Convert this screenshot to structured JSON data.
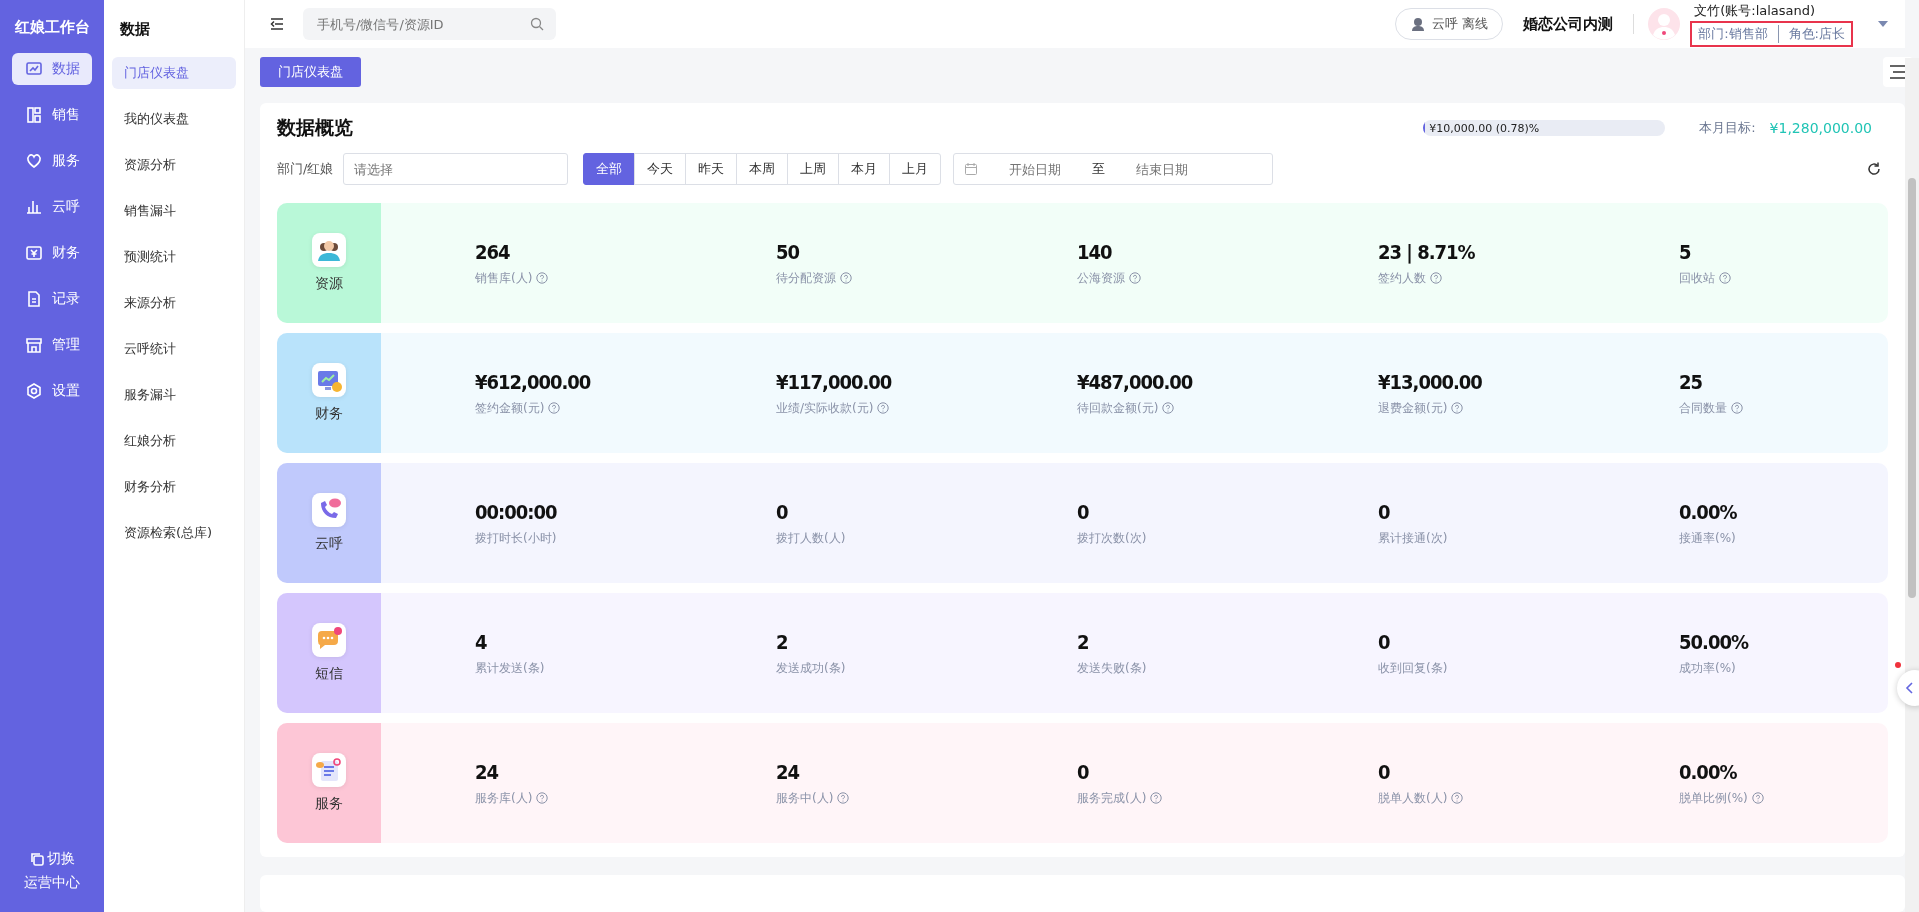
{
  "rail": {
    "title": "红娘工作台",
    "items": [
      {
        "label": "数据",
        "kind": "chart",
        "selected": true
      },
      {
        "label": "销售",
        "kind": "grid",
        "selected": false
      },
      {
        "label": "服务",
        "kind": "heart",
        "selected": false
      },
      {
        "label": "云呼",
        "kind": "bars",
        "selected": false
      },
      {
        "label": "财务",
        "kind": "money",
        "selected": false
      },
      {
        "label": "记录",
        "kind": "doc",
        "selected": false
      },
      {
        "label": "管理",
        "kind": "shop",
        "selected": false
      },
      {
        "label": "设置",
        "kind": "gear",
        "selected": false
      }
    ],
    "switch": {
      "label": "切换",
      "sub": "运营中心"
    }
  },
  "submenu": {
    "title": "数据",
    "items": [
      {
        "label": "门店仪表盘",
        "selected": true
      },
      {
        "label": "我的仪表盘",
        "selected": false
      },
      {
        "label": "资源分析",
        "selected": false
      },
      {
        "label": "销售漏斗",
        "selected": false
      },
      {
        "label": "预测统计",
        "selected": false
      },
      {
        "label": "来源分析",
        "selected": false
      },
      {
        "label": "云呼统计",
        "selected": false
      },
      {
        "label": "服务漏斗",
        "selected": false
      },
      {
        "label": "红娘分析",
        "selected": false
      },
      {
        "label": "财务分析",
        "selected": false
      },
      {
        "label": "资源检索(总库)",
        "selected": false
      }
    ]
  },
  "header": {
    "search": {
      "placeholder": "手机号/微信号/资源ID"
    },
    "call_status": "云呼 离线",
    "company": "婚恋公司内测",
    "user": {
      "name": "文竹(账号:lalasand)",
      "department": "部门:销售部",
      "role": "角色:店长"
    }
  },
  "page_tabs": [
    {
      "label": "门店仪表盘",
      "selected": true
    }
  ],
  "overview": {
    "title": "数据概览",
    "progress": {
      "level": 0.0078,
      "reading": "¥10,000.00 (0.78)%"
    },
    "target_label": "本月目标:",
    "target_value": "¥1,280,000.00",
    "filter_label": "部门/红娘",
    "filter": {
      "placeholder": "请选择"
    },
    "periods": [
      {
        "label": "全部",
        "selected": true
      },
      {
        "label": "今天",
        "selected": false
      },
      {
        "label": "昨天",
        "selected": false
      },
      {
        "label": "本周",
        "selected": false
      },
      {
        "label": "上周",
        "selected": false
      },
      {
        "label": "本月",
        "selected": false
      },
      {
        "label": "上月",
        "selected": false
      }
    ],
    "date_range": {
      "start_placeholder": "开始日期",
      "separator": "至",
      "end_placeholder": "结束日期"
    },
    "groups": [
      {
        "kind": "resource",
        "label": "资源",
        "color": "#b9f8d8",
        "stats": [
          {
            "value": "264",
            "label": "销售库(人)",
            "help": true
          },
          {
            "value": "50",
            "label": "待分配资源",
            "help": true
          },
          {
            "value": "140",
            "label": "公海资源",
            "help": true
          },
          {
            "value": "23 | 8.71%",
            "label": "签约人数",
            "help": true
          },
          {
            "value": "5",
            "label": "回收站",
            "help": true
          }
        ]
      },
      {
        "kind": "finance",
        "label": "财务",
        "color": "#b9e3fb",
        "stats": [
          {
            "value": "¥612,000.00",
            "label": "签约金额(元)",
            "help": true
          },
          {
            "value": "¥117,000.00",
            "label": "业绩/实际收款(元)",
            "help": true
          },
          {
            "value": "¥487,000.00",
            "label": "待回款金额(元)",
            "help": true
          },
          {
            "value": "¥13,000.00",
            "label": "退费金额(元)",
            "help": true
          },
          {
            "value": "25",
            "label": "合同数量",
            "help": true
          }
        ]
      },
      {
        "kind": "call",
        "label": "云呼",
        "color": "#c0c9fc",
        "stats": [
          {
            "value": "00:00:00",
            "label": "拨打时长(小时)",
            "help": false
          },
          {
            "value": "0",
            "label": "拨打人数(人)",
            "help": false
          },
          {
            "value": "0",
            "label": "拨打次数(次)",
            "help": false
          },
          {
            "value": "0",
            "label": "累计接通(次)",
            "help": false
          },
          {
            "value": "0.00%",
            "label": "接通率(%)",
            "help": false
          }
        ]
      },
      {
        "kind": "sms",
        "label": "短信",
        "color": "#d4c6fd",
        "stats": [
          {
            "value": "4",
            "label": "累计发送(条)",
            "help": false
          },
          {
            "value": "2",
            "label": "发送成功(条)",
            "help": false
          },
          {
            "value": "2",
            "label": "发送失败(条)",
            "help": false
          },
          {
            "value": "0",
            "label": "收到回复(条)",
            "help": false
          },
          {
            "value": "50.00%",
            "label": "成功率(%)",
            "help": false
          }
        ]
      },
      {
        "kind": "service",
        "label": "服务",
        "color": "#fdc6d6",
        "stats": [
          {
            "value": "24",
            "label": "服务库(人)",
            "help": true
          },
          {
            "value": "24",
            "label": "服务中(人)",
            "help": true
          },
          {
            "value": "0",
            "label": "服务完成(人)",
            "help": true
          },
          {
            "value": "0",
            "label": "脱单人数(人)",
            "help": true
          },
          {
            "value": "0.00%",
            "label": "脱单比例(%)",
            "help": true
          }
        ]
      }
    ]
  }
}
